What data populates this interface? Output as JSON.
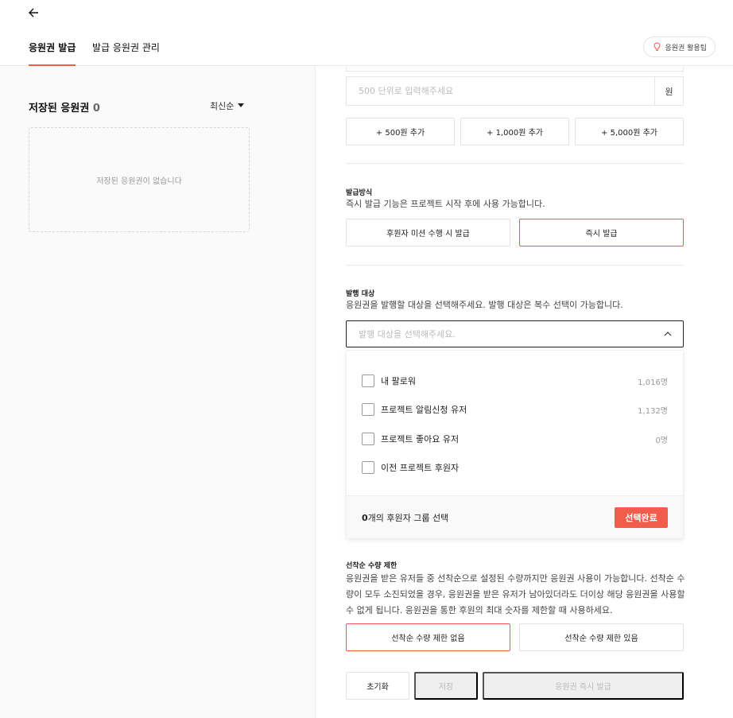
{
  "header": {
    "tabs": [
      {
        "label": "응원권 발급"
      },
      {
        "label": "발급 응원권 관리"
      }
    ],
    "tip_label": "응원권 활용팁",
    "accent": "#f25c4a"
  },
  "left": {
    "title": "저장된 응원권",
    "count": "0",
    "sort_label": "최신순",
    "empty_text": "저장된 응원권이 없습니다"
  },
  "amount": {
    "placeholder": "500 단위로 입력해주세요",
    "unit": "원",
    "add_buttons": [
      "+ 500원 추가",
      "+ 1,000원 추가",
      "+ 5,000원 추가"
    ]
  },
  "method": {
    "label": "발급방식",
    "desc": "즉시 발급 기능은 프로젝트 시작 후에 사용 가능합니다.",
    "options": [
      "후원자 미션 수행 시 발급",
      "즉시 발급"
    ],
    "selected": "즉시 발급"
  },
  "target": {
    "label": "발행 대상",
    "desc": "응원권을 발행할 대상을 선택해주세요. 발행 대상은 복수 선택이 가능합니다.",
    "placeholder": "발행 대상을 선택해주세요.",
    "options": [
      {
        "label": "내 팔로워",
        "count": "1,016명"
      },
      {
        "label": "프로젝트 알림신청 유저",
        "count": "1,132명"
      },
      {
        "label": "프로젝트 좋아요 유저",
        "count": "0명"
      },
      {
        "label": "이전 프로젝트 후원자",
        "count": ""
      }
    ],
    "selected_count": "0",
    "selected_suffix": "개의 후원자 그룹 선택",
    "done_label": "선택완료"
  },
  "limit": {
    "label": "선착순 수량 제한",
    "desc": "응원권을 받은 유저들 중 선착순으로 설정된 수량까지만 응원권 사용이 가능합니다. 선착순 수량이 모두 소진되었을 경우, 응원권을 받은 유저가 남아있더라도 더이상 해당 응원권을 사용할 수 없게 됩니다. 응원권을 통한 후원의 최대 숫자를 제한할 때 사용하세요.",
    "options": [
      "선착순 수량 제한 없음",
      "선착순 수량 제한 있음"
    ],
    "selected": "선착순 수량 제한 없음"
  },
  "actions": {
    "reset": "초기화",
    "save": "저장",
    "issue": "응원권 즉시 발급"
  }
}
